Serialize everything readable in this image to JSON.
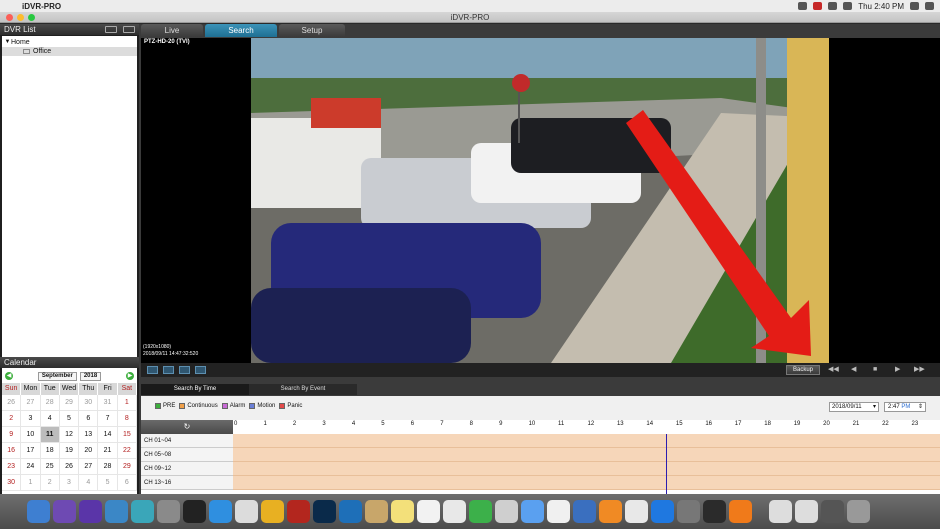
{
  "menubar": {
    "app_name": "iDVR-PRO",
    "clock": "Thu 2:40 PM"
  },
  "window": {
    "title": "iDVR-PRO"
  },
  "dvr_list": {
    "title": "DVR List",
    "items": [
      {
        "label": "Home",
        "toggle": "▼"
      },
      {
        "label": "Office",
        "toggle": ""
      }
    ]
  },
  "tabs": [
    {
      "label": "Live"
    },
    {
      "label": "Search"
    },
    {
      "label": "Setup"
    }
  ],
  "video": {
    "camera_label": "PTZ-HD-20 (TVI)",
    "resolution": "(1920x1080)",
    "timestamp": "2018/09/11 14:47:32:520"
  },
  "toolbar": {
    "backup_label": "Backup",
    "controls": [
      "◀◀",
      "◀",
      "■",
      "▶",
      "▶▶"
    ]
  },
  "calendar": {
    "title": "Calendar",
    "month": "September",
    "year": "2018",
    "dow": [
      "Sun",
      "Mon",
      "Tue",
      "Wed",
      "Thu",
      "Fri",
      "Sat"
    ],
    "weeks": [
      [
        "26",
        "27",
        "28",
        "29",
        "30",
        "31",
        "1"
      ],
      [
        "2",
        "3",
        "4",
        "5",
        "6",
        "7",
        "8"
      ],
      [
        "9",
        "10",
        "11",
        "12",
        "13",
        "14",
        "15"
      ],
      [
        "16",
        "17",
        "18",
        "19",
        "20",
        "21",
        "22"
      ],
      [
        "23",
        "24",
        "25",
        "26",
        "27",
        "28",
        "29"
      ],
      [
        "30",
        "1",
        "2",
        "3",
        "4",
        "5",
        "6"
      ]
    ]
  },
  "search": {
    "tabs": [
      {
        "label": "Search By Time"
      },
      {
        "label": "Search By Event"
      }
    ],
    "legend": [
      {
        "label": "PRE",
        "color": "#3cae3c"
      },
      {
        "label": "Continuous",
        "color": "#f0a04a"
      },
      {
        "label": "Alarm",
        "color": "#c86ad6"
      },
      {
        "label": "Motion",
        "color": "#6a7fd6"
      },
      {
        "label": "Panic",
        "color": "#e24a4a"
      }
    ],
    "date": "2018/09/11",
    "time_value": "2:47",
    "time_ampm": "PM",
    "refresh_icon": "↻",
    "hours": [
      "0",
      "1",
      "2",
      "3",
      "4",
      "5",
      "6",
      "7",
      "8",
      "9",
      "10",
      "11",
      "12",
      "13",
      "14",
      "15",
      "16",
      "17",
      "18",
      "19",
      "20",
      "21",
      "22",
      "23"
    ],
    "channels": [
      "CH 01~04",
      "CH 05~08",
      "CH 09~12",
      "CH 13~16"
    ]
  }
}
